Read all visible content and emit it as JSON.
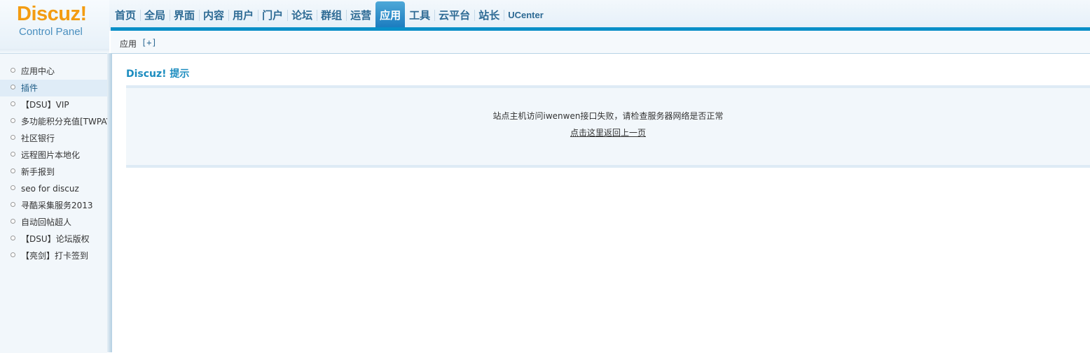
{
  "logo": {
    "main": "Discuz!",
    "sub": "Control Panel"
  },
  "nav": {
    "items": [
      "首页",
      "全局",
      "界面",
      "内容",
      "用户",
      "门户",
      "论坛",
      "群组",
      "运营",
      "应用",
      "工具",
      "云平台",
      "站长",
      "UCenter"
    ],
    "active": "应用"
  },
  "subbar": {
    "label": "应用",
    "plus": "[+]"
  },
  "sidebar": {
    "items": [
      "应用中心",
      "插件",
      "【DSU】VIP",
      "多功能积分充值[TWPAY]",
      "社区银行",
      "远程图片本地化",
      "新手报到",
      "seo for discuz",
      "寻酷采集服务2013",
      "自动回帖超人",
      "【DSU】论坛版权",
      "【亮剑】打卡签到"
    ],
    "selected": "插件"
  },
  "main": {
    "title": "Discuz! 提示",
    "message": "站点主机访问iwenwen接口失败，请检查服务器网络是否正常",
    "back_link": "点击这里返回上一页"
  },
  "colors": {
    "accent_blue": "#0a8fc8",
    "logo_orange": "#f39c12",
    "title_blue": "#1b8cbf"
  }
}
